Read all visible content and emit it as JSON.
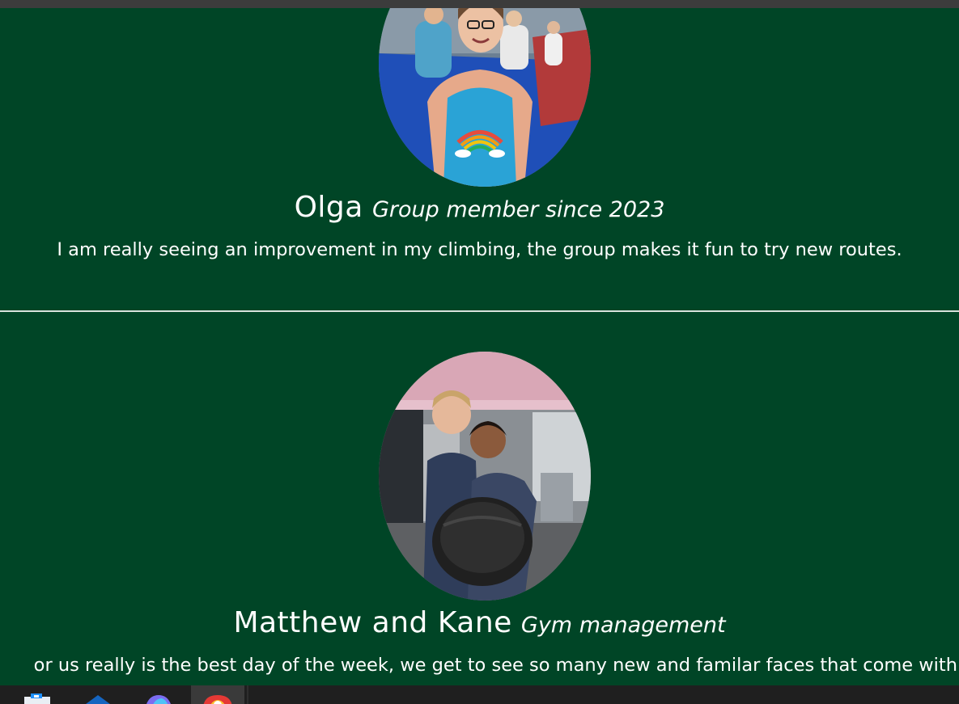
{
  "testimonials": [
    {
      "name": "Olga",
      "role": "Group member since 2023",
      "quote": "I am really seeing an improvement in my climbing, the group makes it fun to try new routes."
    },
    {
      "name": "Matthew and Kane",
      "role": "Gym management",
      "quote": "or us really is the best day of the week, we get to see so many new and familar faces that come with"
    }
  ],
  "taskbar": {
    "icons": [
      "file-explorer-icon",
      "mail-icon",
      "copilot-icon",
      "chrome-icon"
    ]
  },
  "colors": {
    "background": "#004526",
    "divider": "#d8e2dc",
    "taskbar": "#1f1f1f"
  }
}
